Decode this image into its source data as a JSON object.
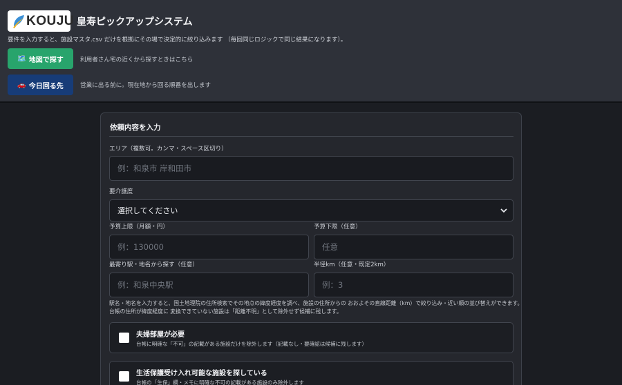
{
  "header": {
    "logo_text": "KOUJU",
    "title": "皇寿ピックアップシステム",
    "lead": "要件を入力すると、施設マスタ.csv だけを根拠にその場で決定的に絞り込みます （毎回同じロジックで同じ結果になります）。",
    "buttons": [
      {
        "icon": "map-icon",
        "glyph": "🗺️",
        "label": "地図で探す",
        "hint": "利用者さん宅の近くから探すときはこちら",
        "color": "#28a46c"
      },
      {
        "icon": "car-icon",
        "glyph": "🚗",
        "label": "今日回る先",
        "hint": "営業に出る前に。現在地から回る順番を出します",
        "color": "#173c78"
      }
    ]
  },
  "form": {
    "title": "依頼内容を入力",
    "area": {
      "label": "エリア（複数可。カンマ・スペース区切り）",
      "placeholder": "例：和泉市 岸和田市",
      "value": ""
    },
    "care_level": {
      "label": "要介護度",
      "selected": "選択してください"
    },
    "budget_max": {
      "label": "予算上限（月額・円）",
      "placeholder": "例：130000",
      "value": ""
    },
    "budget_min": {
      "label": "予算下限（任意）",
      "placeholder": "任意",
      "value": ""
    },
    "station": {
      "label": "最寄り駅・地名から探す（任意）",
      "placeholder": "例：和泉中央駅",
      "value": ""
    },
    "radius": {
      "label": "半径km（任意・既定2km）",
      "placeholder": "例：3",
      "value": ""
    },
    "note_line1": "駅名・地名を入力すると、国土地理院の住所検索でその地点の緯度経度を調べ、施設の住所からの おおよその直線距離（km）で絞り込み・近い順の並び替えができます。台帳の住所が緯度経度に 変換できていない施設は「距離不明」として除外せず候補に残します。",
    "checks": [
      {
        "title": "夫婦部屋が必要",
        "desc": "台帳に明確な「不可」の記載がある施設だけを除外します（記載なし・要確認は候補に残します）"
      },
      {
        "title": "生活保護受け入れ可能な施設を探している",
        "desc": "台帳の「生保」欄・メモに明確な不可の記載がある施設のみ除外します"
      }
    ]
  },
  "colors": {
    "header_bg": "#2e3139",
    "page_bg": "#1b1d22",
    "panel_bg": "#25272d",
    "accent_green": "#28a46c",
    "accent_blue": "#173c78"
  }
}
